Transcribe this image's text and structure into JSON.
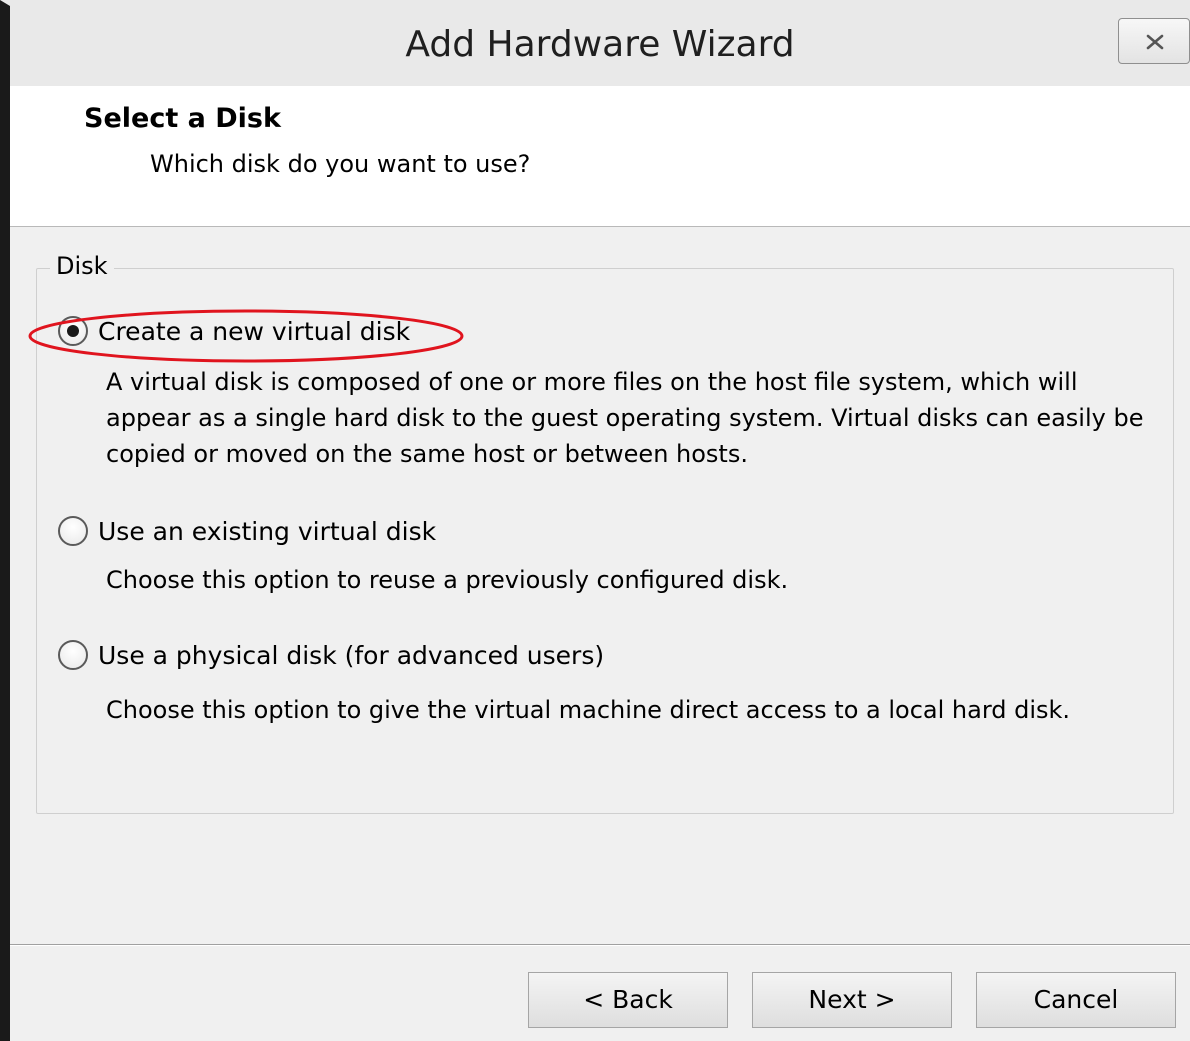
{
  "window": {
    "title": "Add Hardware Wizard"
  },
  "header": {
    "title": "Select a Disk",
    "subtitle": "Which disk do you want to use?"
  },
  "disk_group": {
    "label": "Disk",
    "options": [
      {
        "label": "Create a new virtual disk",
        "checked": true,
        "description": "A virtual disk is composed of one or more files on the host file system, which will appear as a single hard disk to the guest operating system. Virtual disks can easily be copied or moved on the same host or between hosts."
      },
      {
        "label": "Use an existing virtual disk",
        "checked": false,
        "description": "Choose this option to reuse a previously configured disk."
      },
      {
        "label": "Use a physical disk (for advanced users)",
        "checked": false,
        "description": "Choose this option to give the virtual machine direct access to a local hard disk."
      }
    ]
  },
  "buttons": {
    "back": "< Back",
    "next": "Next >",
    "cancel": "Cancel"
  },
  "colors": {
    "annotation": "#e0141e",
    "window_bg": "#f0f0f0"
  },
  "icons": {
    "close": "close-icon"
  }
}
